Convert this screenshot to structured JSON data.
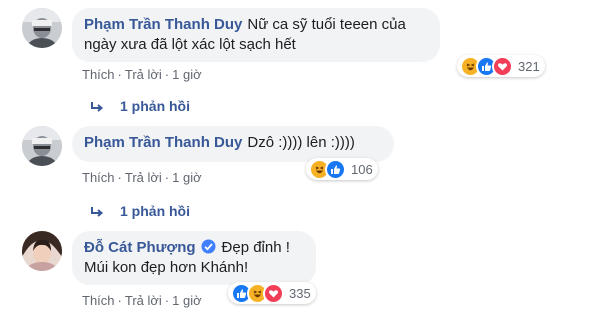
{
  "comments": [
    {
      "author": "Phạm Trần Thanh Duy",
      "verified": false,
      "text": "Nữ ca sỹ tuổi teeen của ngày xưa đã lột xác lột sạch hết",
      "like": "Thích",
      "reply": "Trả lời",
      "time": "1 giờ",
      "reaction_count": "321",
      "reactions": [
        "haha",
        "like",
        "love"
      ],
      "replies_label": "1 phản hồi"
    },
    {
      "author": "Phạm Trần Thanh Duy",
      "verified": false,
      "text": "Dzô :)))) lên :))))",
      "like": "Thích",
      "reply": "Trả lời",
      "time": "1 giờ",
      "reaction_count": "106",
      "reactions": [
        "haha",
        "like"
      ],
      "replies_label": "1 phản hồi"
    },
    {
      "author": "Đỗ Cát Phượng",
      "verified": true,
      "text": "Đẹp đỉnh ! Múi kon đẹp hơn Khánh!",
      "like": "Thích",
      "reply": "Trả lời",
      "time": "1 giờ",
      "reaction_count": "335",
      "reactions": [
        "like",
        "haha",
        "love"
      ]
    }
  ],
  "icons": {
    "reply_arrow": "reply-arrow-icon",
    "verified": "verified-badge-icon",
    "like": "like-reaction-icon",
    "haha": "haha-reaction-icon",
    "love": "love-reaction-icon"
  },
  "colors": {
    "author": "#385898",
    "bubble": "#f2f3f5",
    "meta": "#616770",
    "like": "#1877f2",
    "love": "#f33e58",
    "haha": "#f7b125"
  }
}
